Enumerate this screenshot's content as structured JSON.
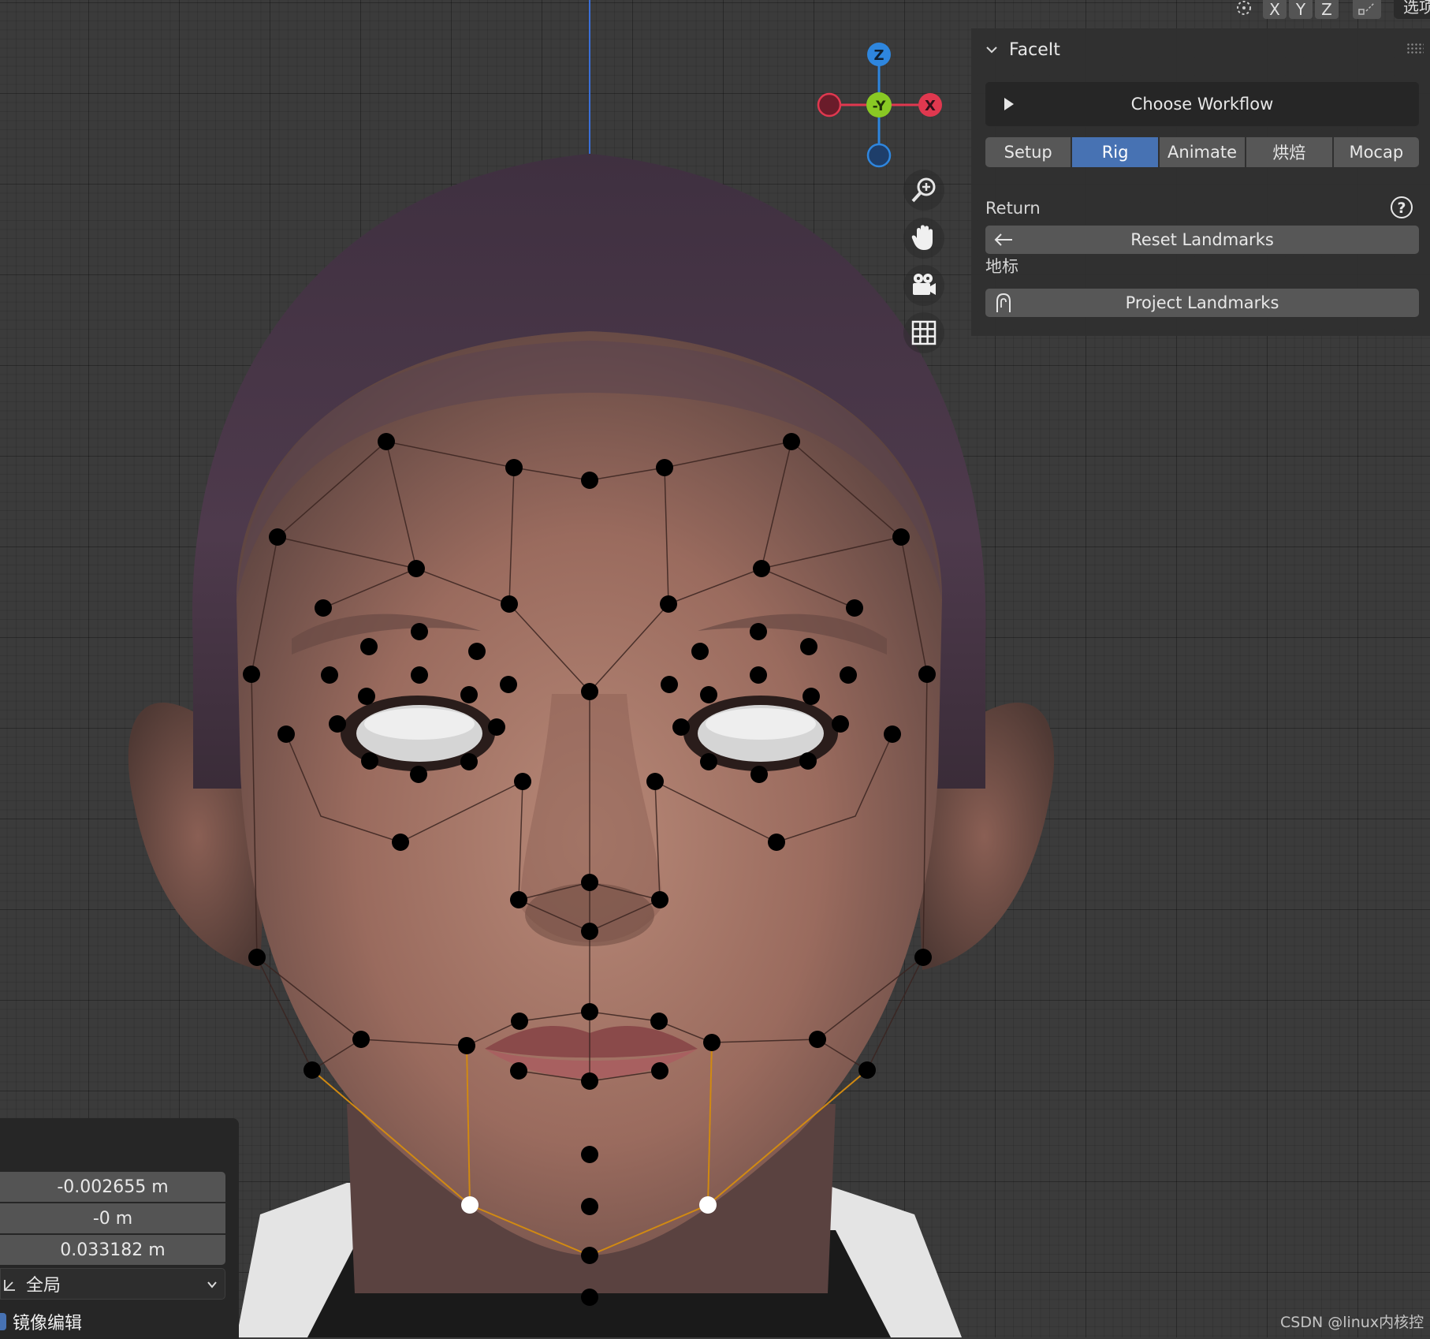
{
  "header": {
    "pivot_icon": "pivot-icon",
    "axis_buttons": [
      "X",
      "Y",
      "Z"
    ],
    "snap_icon": "snap-icon",
    "options_label": "选项"
  },
  "gizmo": {
    "axis_labels": {
      "z": "Z",
      "y": "-Y",
      "x": "X"
    },
    "colors": {
      "x": "#e0384f",
      "y": "#89c924",
      "z": "#2e86de"
    },
    "buttons": [
      "zoom-icon",
      "hand-pan-icon",
      "camera-icon",
      "grid-ortho-icon"
    ]
  },
  "sidebar": {
    "panel_title": "FaceIt",
    "workflow_button": "Choose Workflow",
    "tabs": [
      {
        "label": "Setup",
        "active": false
      },
      {
        "label": "Rig",
        "active": true
      },
      {
        "label": "Animate",
        "active": false
      },
      {
        "label": "烘焙",
        "active": false
      },
      {
        "label": "Mocap",
        "active": false
      }
    ],
    "return_label": "Return",
    "reset_button": "Reset Landmarks",
    "landmarks_label": "地标",
    "project_button": "Project Landmarks",
    "accent": "#4772b3"
  },
  "operator_panel": {
    "values": [
      "-0.002655 m",
      "-0 m",
      "0.033182 m"
    ],
    "orientation": "全局",
    "mirror_label": "镜像编辑",
    "mirror_checked": true
  },
  "viewport": {
    "landmark_color": "#000000",
    "selected_landmark_color": "#ffffff",
    "selected_edge_color": "#d18a12",
    "skin_color": "#a8786a",
    "hair_color": "#4a3848"
  },
  "watermark": "CSDN @linux内核控"
}
